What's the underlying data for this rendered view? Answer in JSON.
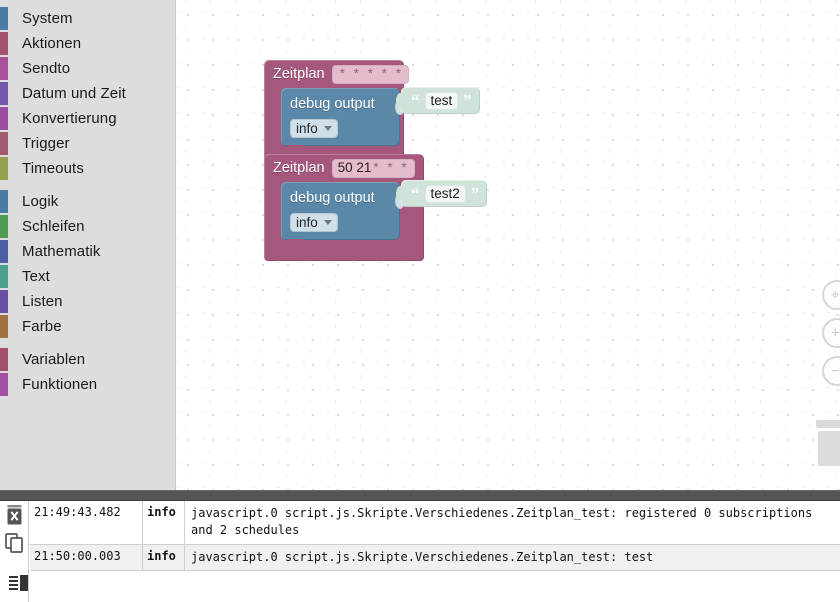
{
  "toolbox": {
    "groups": [
      {
        "items": [
          {
            "label": "System",
            "color": "#4a7ba6"
          },
          {
            "label": "Aktionen",
            "color": "#a4546c"
          },
          {
            "label": "Sendto",
            "color": "#a8519a"
          },
          {
            "label": "Datum und Zeit",
            "color": "#7457a8"
          },
          {
            "label": "Konvertierung",
            "color": "#9b4fa3"
          },
          {
            "label": "Trigger",
            "color": "#a45a6e"
          },
          {
            "label": "Timeouts",
            "color": "#96a04f"
          }
        ]
      },
      {
        "items": [
          {
            "label": "Logik",
            "color": "#4a7ba6"
          },
          {
            "label": "Schleifen",
            "color": "#4d9a52"
          },
          {
            "label": "Mathematik",
            "color": "#4c5fa3"
          },
          {
            "label": "Text",
            "color": "#4aa08c"
          },
          {
            "label": "Listen",
            "color": "#6b4fa6"
          },
          {
            "label": "Farbe",
            "color": "#a5703f"
          }
        ]
      },
      {
        "items": [
          {
            "label": "Variablen",
            "color": "#a3506b"
          },
          {
            "label": "Funktionen",
            "color": "#a350a3"
          }
        ]
      }
    ]
  },
  "workspace": {
    "blocks": [
      {
        "schedule_title": "Zeitplan",
        "cron_numbers": "",
        "cron_stars": "* * * * *",
        "debug_label": "debug output",
        "severity": "info",
        "text_value": "test",
        "quote_open": "“",
        "quote_close": "”"
      },
      {
        "schedule_title": "Zeitplan",
        "cron_numbers": "50 21",
        "cron_stars": "* * *",
        "debug_label": "debug output",
        "severity": "info",
        "text_value": "test2",
        "quote_open": "“",
        "quote_close": "”"
      }
    ],
    "zoom_controls": [
      {
        "name": "zoom-reset-control",
        "glyph": "⌖"
      },
      {
        "name": "zoom-in-control",
        "glyph": "+"
      },
      {
        "name": "zoom-out-control",
        "glyph": "−"
      }
    ],
    "trash_name": "trash-can"
  },
  "log": {
    "tools": [
      {
        "name": "clear-log-button"
      },
      {
        "name": "copy-log-button"
      },
      {
        "name": "log-settings-button"
      }
    ],
    "rows": [
      {
        "time": "21:49:43.482",
        "severity": "info",
        "message": "javascript.0 script.js.Skripte.Verschiedenes.Zeitplan_test: registered 0 subscriptions and 2 schedules"
      },
      {
        "time": "21:50:00.003",
        "severity": "info",
        "message": "javascript.0 script.js.Skripte.Verschiedenes.Zeitplan_test: test"
      }
    ]
  },
  "colors": {
    "schedule_block": "#a5577c",
    "debug_block": "#5b87a8",
    "text_block": "#cfe3d8",
    "toolbox_bg": "#dddddd",
    "splitter": "#555555"
  }
}
